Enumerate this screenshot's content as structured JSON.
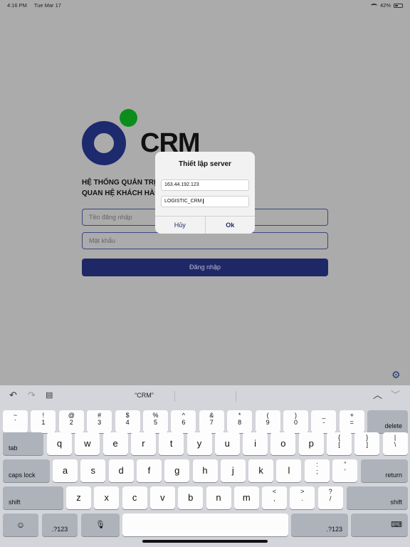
{
  "status": {
    "time": "4:16 PM",
    "date": "Tue Mar 17",
    "battery": "42%"
  },
  "logo": {
    "text": "CRM"
  },
  "tagline": {
    "line1": "HỆ THỐNG QUẢN TRỊ",
    "line2": "QUAN HỆ KHÁCH HÀNG"
  },
  "login": {
    "username_placeholder": "Tên đăng nhập",
    "password_placeholder": "Mật khẩu",
    "submit_label": "Đăng nhập"
  },
  "dialog": {
    "title": "Thiết lập server",
    "server_ip": "163.44.192.123",
    "db_name": "LOGISTIC_CRM",
    "cancel_label": "Hủy",
    "ok_label": "Ok"
  },
  "keyboard": {
    "suggestion": "“CRM”",
    "row1": [
      {
        "top": "~",
        "bot": "`"
      },
      {
        "top": "!",
        "bot": "1"
      },
      {
        "top": "@",
        "bot": "2"
      },
      {
        "top": "#",
        "bot": "3"
      },
      {
        "top": "$",
        "bot": "4"
      },
      {
        "top": "%",
        "bot": "5"
      },
      {
        "top": "^",
        "bot": "6"
      },
      {
        "top": "&",
        "bot": "7"
      },
      {
        "top": "*",
        "bot": "8"
      },
      {
        "top": "(",
        "bot": "9"
      },
      {
        "top": ")",
        "bot": "0"
      },
      {
        "top": "_",
        "bot": "-"
      },
      {
        "top": "+",
        "bot": "="
      }
    ],
    "delete_label": "delete",
    "tab_label": "tab",
    "row2": [
      "q",
      "w",
      "e",
      "r",
      "t",
      "y",
      "u",
      "i",
      "o",
      "p"
    ],
    "row2_sym": [
      {
        "top": "{",
        "bot": "["
      },
      {
        "top": "}",
        "bot": "]"
      },
      {
        "top": "|",
        "bot": "\\"
      }
    ],
    "caps_label": "caps lock",
    "row3": [
      "a",
      "s",
      "d",
      "f",
      "g",
      "h",
      "j",
      "k",
      "l"
    ],
    "row3_sym": [
      {
        "top": ":",
        "bot": ";"
      },
      {
        "top": "”",
        "bot": "’"
      }
    ],
    "return_label": "return",
    "shift_label": "shift",
    "row4": [
      "z",
      "x",
      "c",
      "v",
      "b",
      "n",
      "m"
    ],
    "row4_sym": [
      {
        "top": "<",
        "bot": ","
      },
      {
        "top": ">",
        "bot": "."
      },
      {
        "top": "?",
        "bot": "/"
      }
    ],
    "numbers_label": ".?123"
  }
}
